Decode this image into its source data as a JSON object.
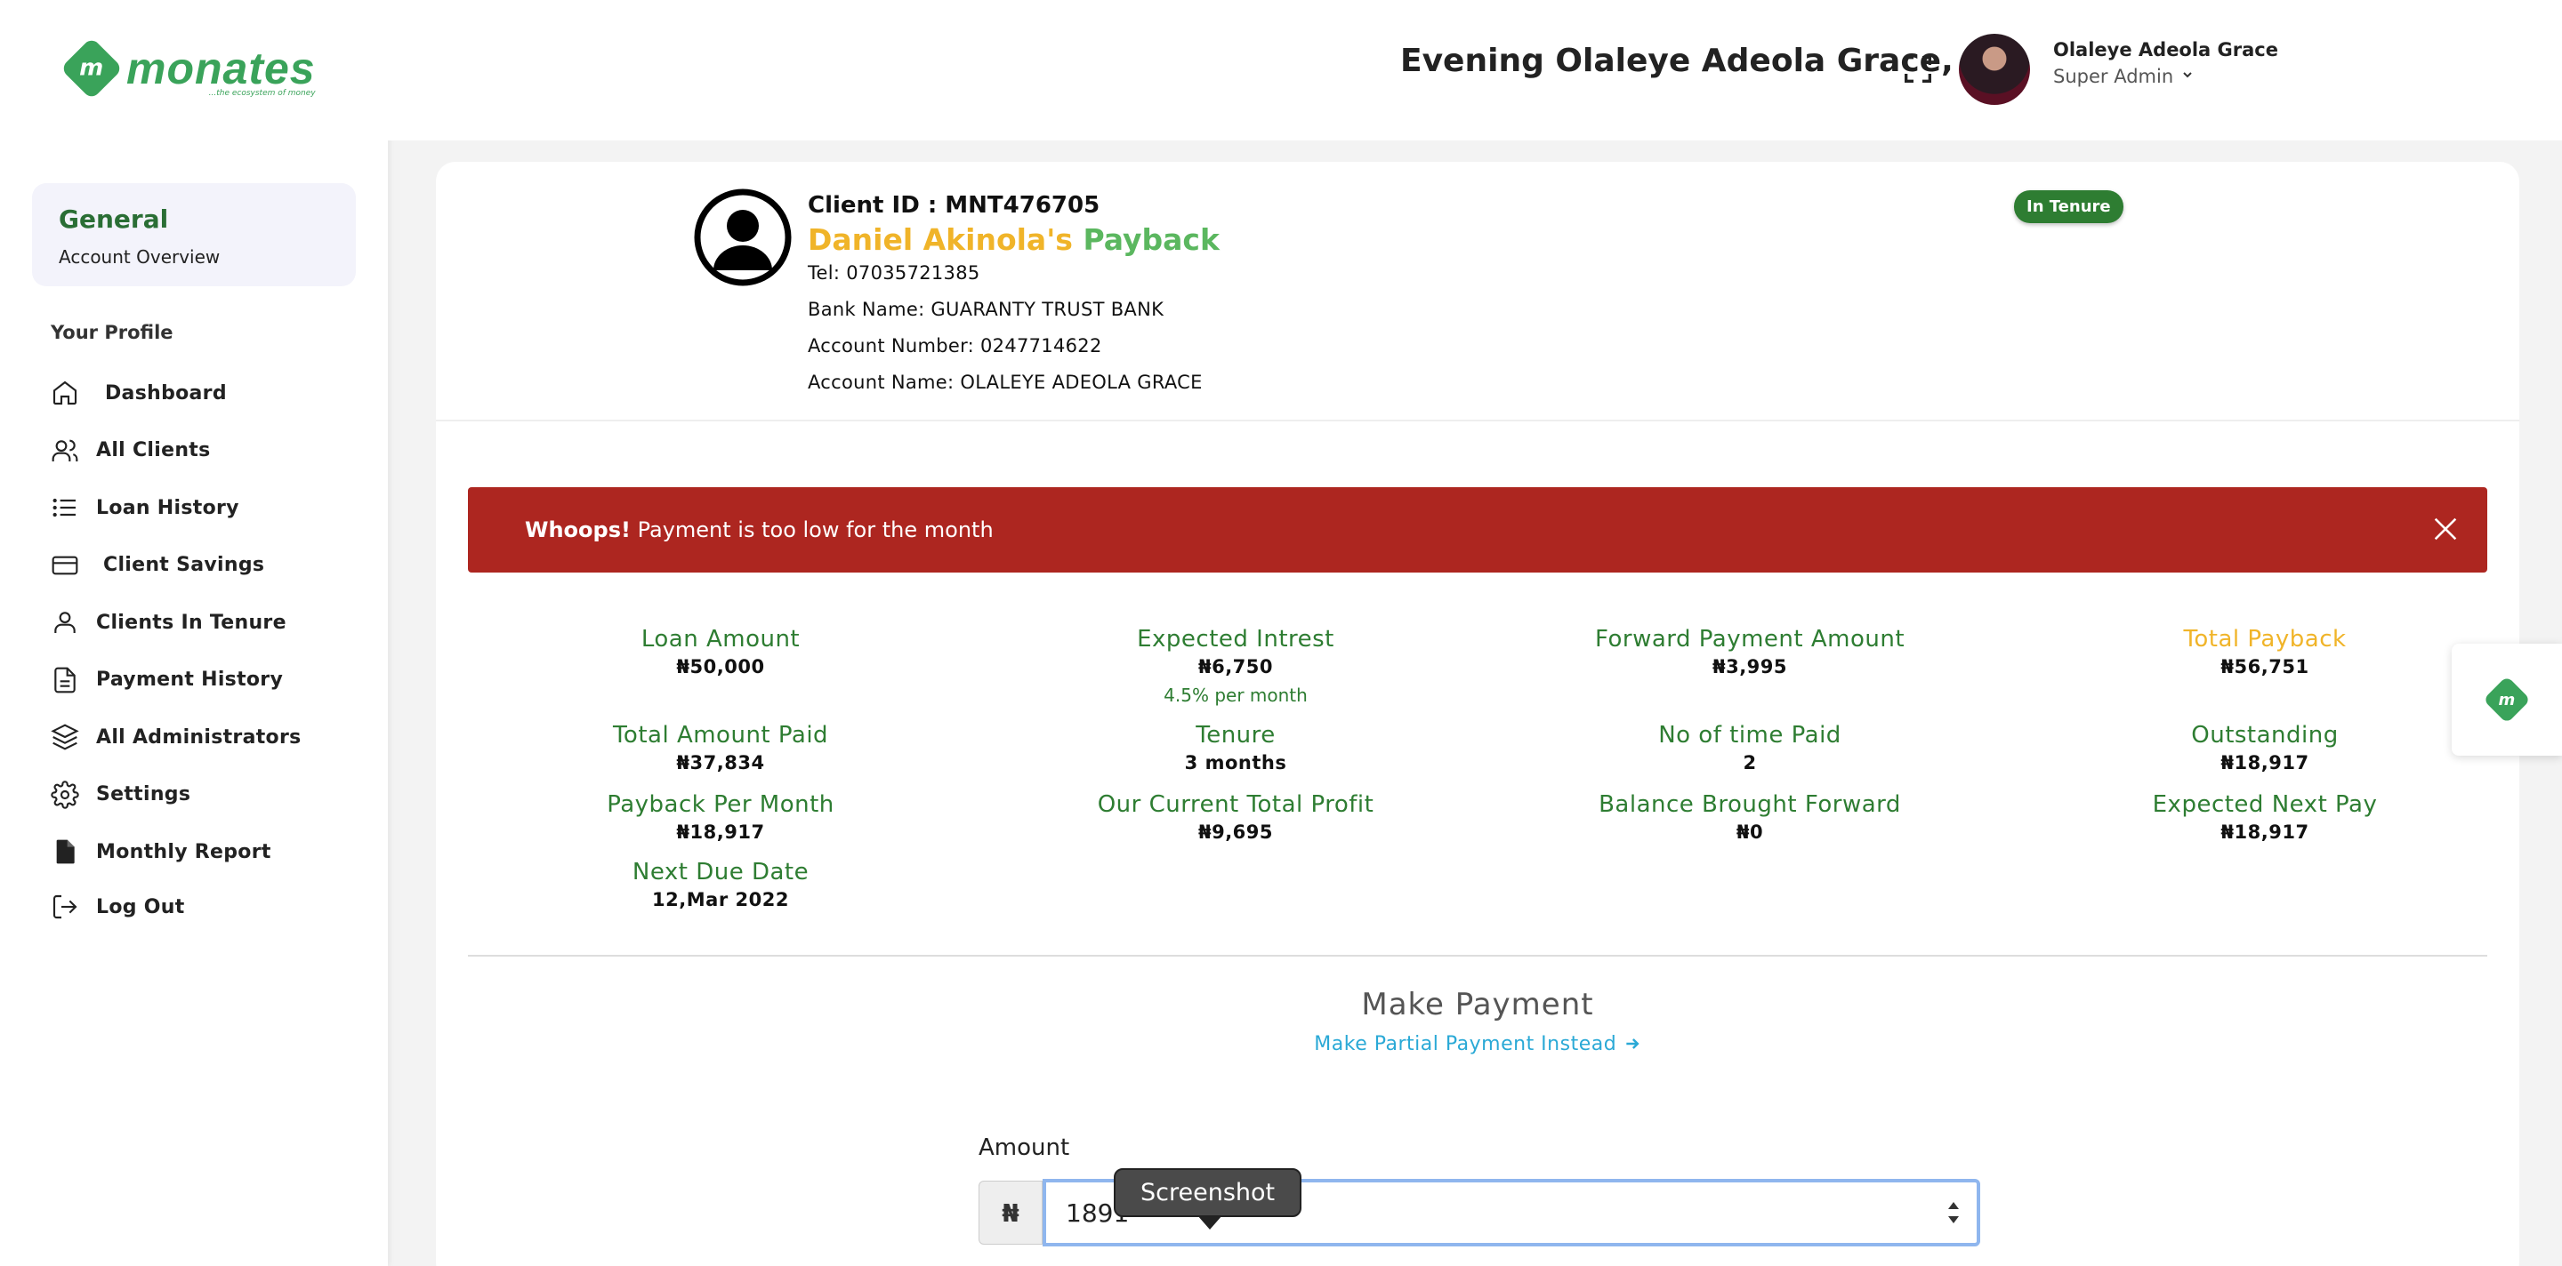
{
  "brand": {
    "name": "monates",
    "tagline": "...the ecosystem of money",
    "color": "#3aa35a"
  },
  "sidebar": {
    "card_title": "General",
    "card_subtitle": "Account Overview",
    "section_title": "Your Profile",
    "items": [
      {
        "label": "Dashboard",
        "icon": "home-icon"
      },
      {
        "label": "All Clients",
        "icon": "users-icon"
      },
      {
        "label": "Loan History",
        "icon": "list-icon"
      },
      {
        "label": "Client Savings",
        "icon": "credit-card-icon"
      },
      {
        "label": "Clients In Tenure",
        "icon": "user-icon"
      },
      {
        "label": "Payment History",
        "icon": "document-icon"
      },
      {
        "label": "All Administrators",
        "icon": "layers-icon"
      },
      {
        "label": "Settings",
        "icon": "gear-icon"
      },
      {
        "label": "Monthly Report",
        "icon": "file-icon"
      },
      {
        "label": "Log Out",
        "icon": "logout-icon"
      }
    ]
  },
  "header": {
    "greeting": "Evening Olaleye Adeola Grace,",
    "user_name": "Olaleye Adeola Grace",
    "user_role": "Super Admin"
  },
  "client": {
    "id_line": "Client ID : MNT476705",
    "name_part1": "Daniel Akinola's",
    "name_part2": "Payback",
    "tel": "Tel: 07035721385",
    "bank": "Bank Name: GUARANTY TRUST BANK",
    "account_number": "Account Number: 0247714622",
    "account_name": "Account Name: OLALEYE ADEOLA GRACE",
    "status_badge": "In Tenure"
  },
  "alert": {
    "strong": "Whoops!",
    "message": "Payment is too low for the month",
    "color": "#ad2620"
  },
  "stats": {
    "loan_amount": {
      "label": "Loan Amount",
      "value": "₦50,000"
    },
    "expected_interest": {
      "label": "Expected Intrest",
      "value": "₦6,750",
      "note": "4.5% per month"
    },
    "forward_payment": {
      "label": "Forward Payment Amount",
      "value": "₦3,995"
    },
    "total_payback": {
      "label": "Total Payback",
      "value": "₦56,751"
    },
    "total_paid": {
      "label": "Total Amount Paid",
      "value": "₦37,834"
    },
    "tenure": {
      "label": "Tenure",
      "value": "3 months"
    },
    "times_paid": {
      "label": "No of time Paid",
      "value": "2"
    },
    "outstanding": {
      "label": "Outstanding",
      "value": "₦18,917"
    },
    "payback_month": {
      "label": "Payback Per Month",
      "value": "₦18,917"
    },
    "current_profit": {
      "label": "Our Current Total Profit",
      "value": "₦9,695"
    },
    "balance_forward": {
      "label": "Balance Brought Forward",
      "value": "₦0"
    },
    "expected_next": {
      "label": "Expected Next Pay",
      "value": "₦18,917"
    },
    "next_due": {
      "label": "Next Due Date",
      "value": "12,Mar 2022"
    }
  },
  "payment": {
    "title": "Make Payment",
    "partial_link": "Make Partial Payment Instead",
    "amount_label": "Amount",
    "currency_symbol": "₦",
    "amount_value": "1891",
    "tooltip": "Screenshot"
  }
}
